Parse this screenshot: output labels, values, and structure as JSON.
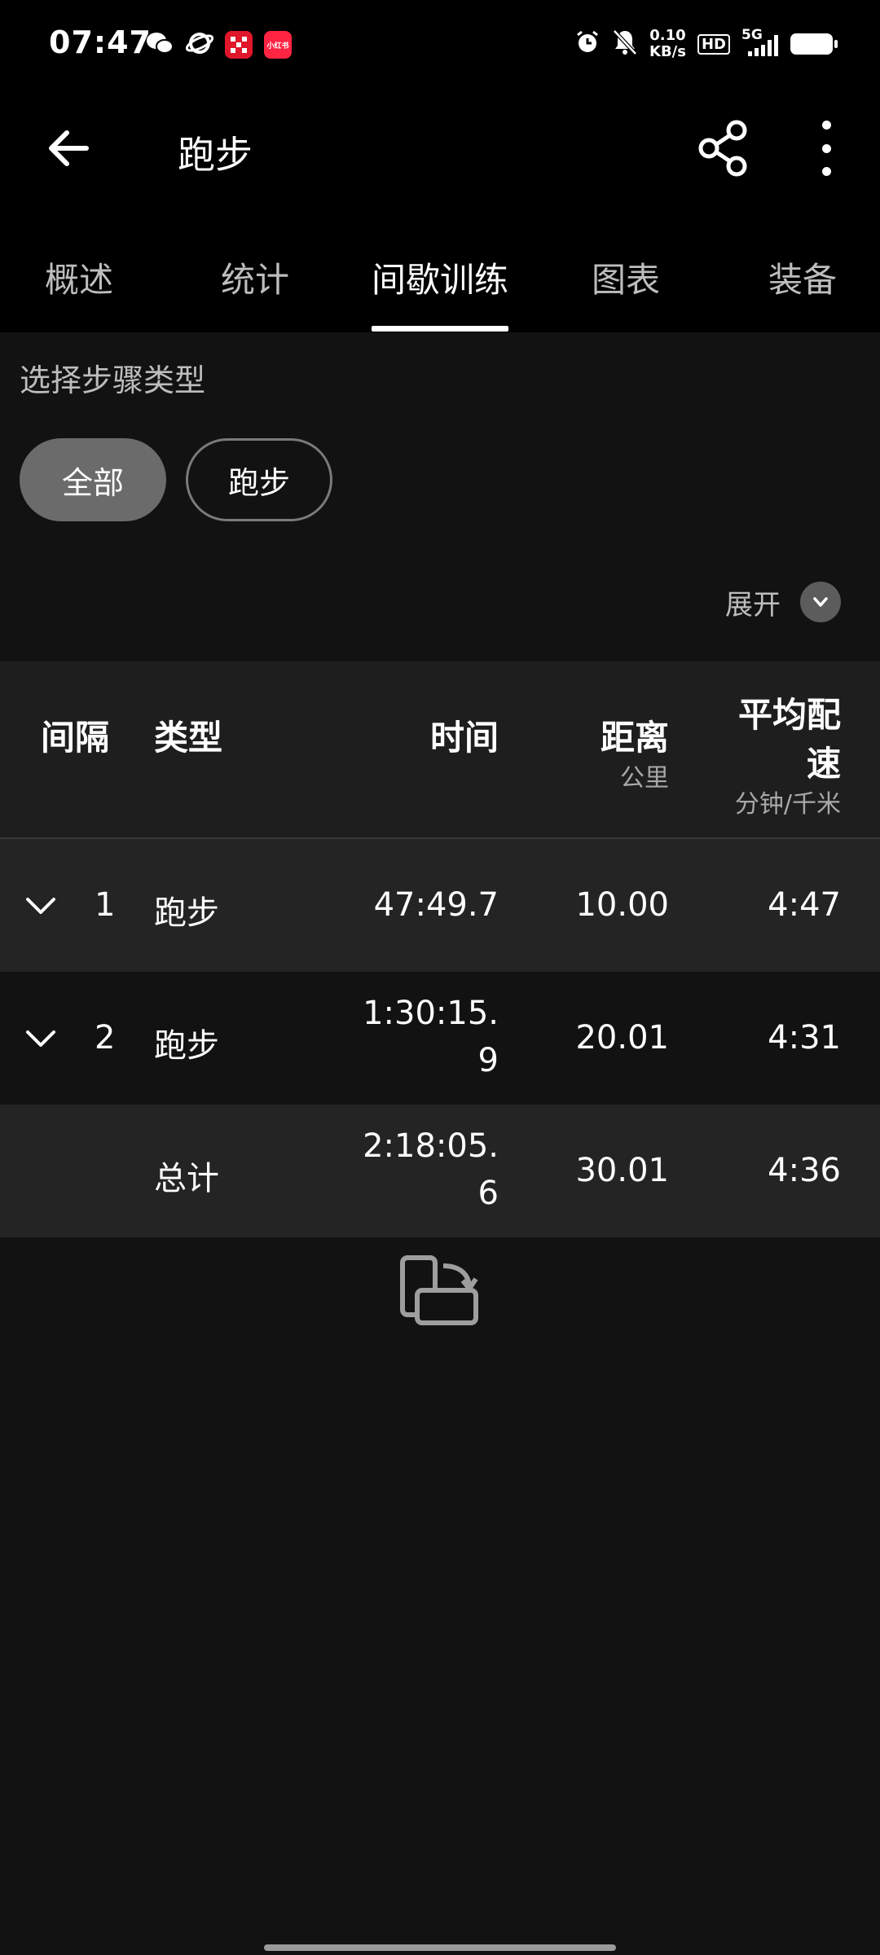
{
  "status_bar": {
    "time": "07:47",
    "net_speed_value": "0.10",
    "net_speed_unit": "KB/s",
    "hd_label": "HD",
    "network": "5G",
    "icons": [
      "wechat-icon",
      "browser-icon",
      "game-icon",
      "xiaohongshu-icon",
      "alarm-icon",
      "mute-icon",
      "hd-icon",
      "signal-icon",
      "battery-icon"
    ],
    "app_badge_text": "小红书"
  },
  "app_bar": {
    "title": "跑步"
  },
  "tabs": [
    {
      "label": "概述"
    },
    {
      "label": "统计"
    },
    {
      "label": "间歇训练"
    },
    {
      "label": "图表"
    },
    {
      "label": "装备"
    }
  ],
  "active_tab": 2,
  "filter": {
    "label": "选择步骤类型",
    "chips": [
      "全部",
      "跑步"
    ],
    "selected": "全部"
  },
  "expand_label": "展开",
  "table": {
    "headers": {
      "interval": "间隔",
      "type": "类型",
      "time": "时间",
      "distance": "距离",
      "distance_unit": "公里",
      "pace_line1": "平均配",
      "pace_line2": "速",
      "pace_unit": "分钟/千米"
    },
    "rows": [
      {
        "interval": "1",
        "type": "跑步",
        "time": "47:49.7",
        "distance": "10.00",
        "pace": "4:47"
      },
      {
        "interval": "2",
        "type": "跑步",
        "time_line1": "1:30:15.",
        "time_line2": "9",
        "distance": "20.01",
        "pace": "4:31"
      }
    ],
    "total": {
      "type": "总计",
      "time_line1": "2:18:05.",
      "time_line2": "6",
      "distance": "30.01",
      "pace": "4:36"
    }
  },
  "colors": {
    "background": "#121212",
    "bar_background": "#000000",
    "selected_chip": "#6b6b6b",
    "row_shade": "#242424"
  }
}
